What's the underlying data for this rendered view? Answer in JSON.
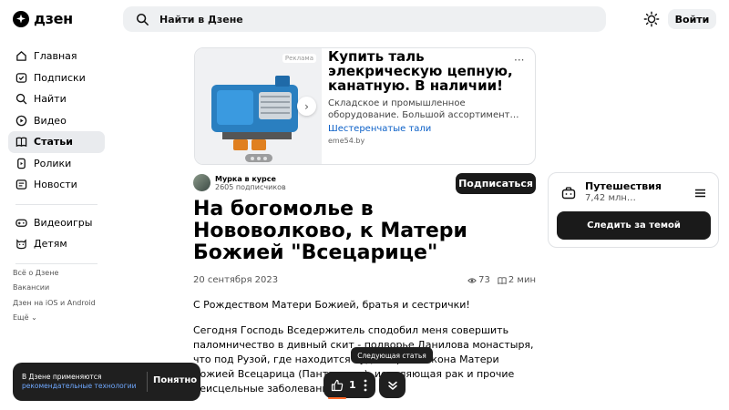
{
  "header": {
    "logo_text": "дзен",
    "search_placeholder": "Найти в Дзене",
    "login_label": "Войти"
  },
  "sidebar": {
    "items": [
      {
        "label": "Главная",
        "icon": "home-icon",
        "active": false
      },
      {
        "label": "Подписки",
        "icon": "subscriptions-icon",
        "active": false
      },
      {
        "label": "Найти",
        "icon": "search-icon",
        "active": false
      },
      {
        "label": "Видео",
        "icon": "play-icon",
        "active": false
      },
      {
        "label": "Статьи",
        "icon": "article-icon",
        "active": true
      },
      {
        "label": "Ролики",
        "icon": "shorts-icon",
        "active": false
      },
      {
        "label": "Новости",
        "icon": "news-icon",
        "active": false
      }
    ],
    "items2": [
      {
        "label": "Видеоигры",
        "icon": "gamepad-icon"
      },
      {
        "label": "Детям",
        "icon": "kids-icon"
      }
    ],
    "footer": [
      "Всё о Дзене",
      "Вакансии",
      "Дзен на iOS и Android",
      "Ещё"
    ]
  },
  "ad": {
    "badge": "Реклама",
    "title": "Купить таль элекрическую цепную, канатную. В наличии!",
    "description": "Складское и промышленное оборудование. Большой ассортимент…",
    "link": "Шестеренчатые тали",
    "domain": "eme54.by"
  },
  "author": {
    "name": "Мурка в курсе",
    "subscribers": "2605 подписчиков",
    "subscribe_label": "Подписаться"
  },
  "article": {
    "title": "На богомолье в Нововолково, к Матери Божией \"Всецарице\"",
    "date": "20 сентября 2023",
    "views": "73",
    "read_time": "2 мин",
    "para1": "С Рождеством Матери Божией, братья и сестрички!",
    "para2": "Сегодня Господь Вседержитель сподобил меня совершить паломничество в дивный скит - подворье Данилова монастыря, что под Рузой, где находится чудотворная икона Матери Божией Всецарица (Пантанасса), исцеляющая рак и прочие неисцельные заболевания."
  },
  "topic": {
    "name": "Путешествия",
    "count": "7,42 млн…",
    "follow_label": "Следить за темой"
  },
  "cookie": {
    "text": "В Дзене применяются",
    "link": "рекомендательные технологии",
    "ok_label": "Понятно"
  },
  "bottom": {
    "tooltip": "Следующая статья",
    "likes": "1"
  }
}
